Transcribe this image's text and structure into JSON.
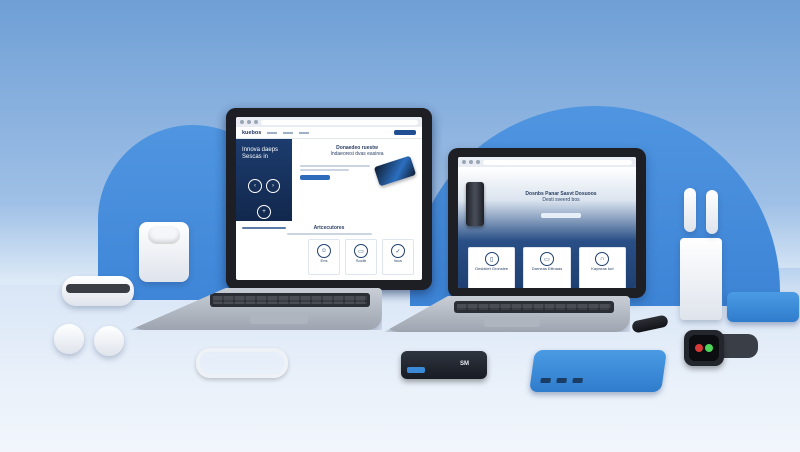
{
  "scene": {
    "background_colors": {
      "sky": "#6f9fd6",
      "arch": "#4a8fdc",
      "floor": "#eef4fb",
      "accent": "#2f6bbb"
    },
    "items": [
      "laptop-left",
      "laptop-right",
      "airpods-case",
      "earbuds-case",
      "loose-earbuds",
      "earbuds-with-stand",
      "cable",
      "portable-ssd",
      "power-bank",
      "smartwatch",
      "usb-stick",
      "blue-charging-case"
    ]
  },
  "laptop_left": {
    "nav_logo": "kuebos",
    "hero_heading": "Innova daeps",
    "hero_sub": "Sescas in",
    "feature_heading": "Donaedeo ruestw",
    "feature_sub": "Indaeoresi dvas easirea",
    "section_heading": "Artcecutores",
    "card_labels": [
      "Ens",
      "Soctb",
      "tkca"
    ]
  },
  "laptop_right": {
    "hero_heading": "Dosnbs Panar Sasvt Dosuoos",
    "hero_sub": "Desti sveerd bos",
    "card_labels": [
      "Desbkiet Gronsiee",
      "Darneas Elitnaas",
      "Kayneas tod"
    ]
  },
  "ssd_label": "SM"
}
